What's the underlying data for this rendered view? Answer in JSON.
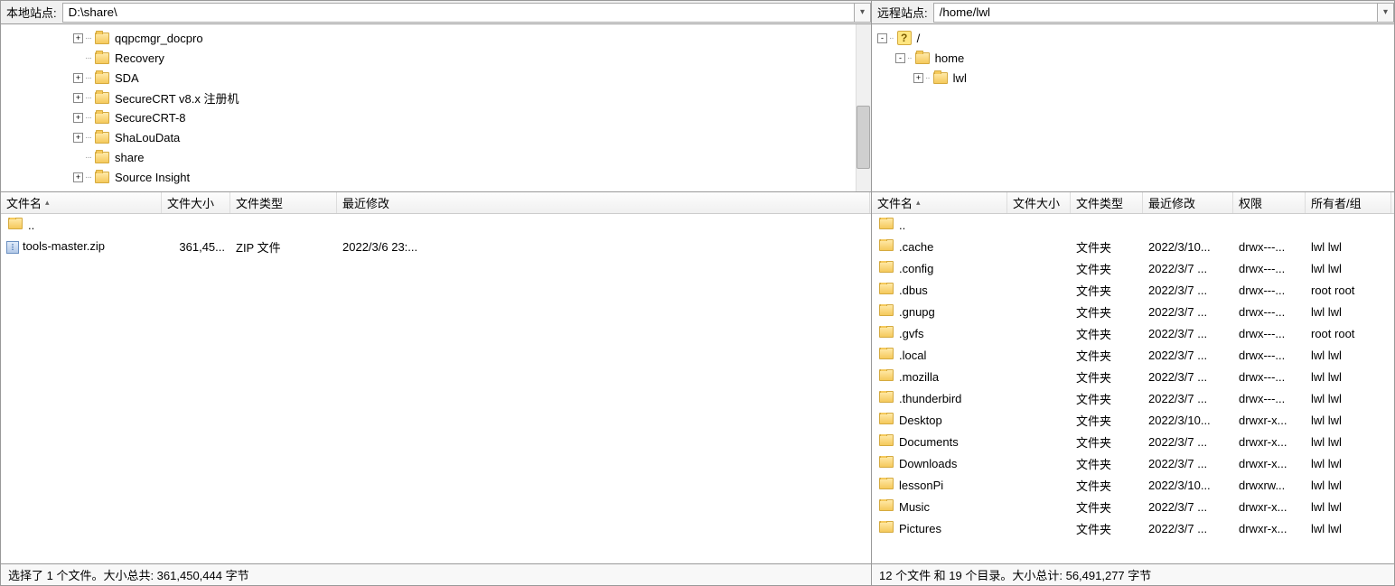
{
  "local": {
    "path_label": "本地站点:",
    "path_value": "D:\\share\\",
    "tree": [
      {
        "indent": 80,
        "toggle": "+",
        "name": "qqpcmgr_docpro"
      },
      {
        "indent": 80,
        "toggle": "",
        "name": "Recovery"
      },
      {
        "indent": 80,
        "toggle": "+",
        "name": "SDA"
      },
      {
        "indent": 80,
        "toggle": "+",
        "name": "SecureCRT v8.x 注册机"
      },
      {
        "indent": 80,
        "toggle": "+",
        "name": "SecureCRT-8"
      },
      {
        "indent": 80,
        "toggle": "+",
        "name": "ShaLouData"
      },
      {
        "indent": 80,
        "toggle": "",
        "name": "share"
      },
      {
        "indent": 80,
        "toggle": "+",
        "name": "Source Insight"
      }
    ],
    "headers": {
      "name": "文件名",
      "size": "文件大小",
      "type": "文件类型",
      "date": "最近修改"
    },
    "files": [
      {
        "icon": "parent",
        "name": ".."
      },
      {
        "icon": "zip",
        "name": "tools-master.zip",
        "size": "361,45...",
        "type": "ZIP 文件",
        "date": "2022/3/6 23:..."
      }
    ],
    "status": "选择了 1 个文件。大小总共: 361,450,444 字节"
  },
  "remote": {
    "path_label": "远程站点:",
    "path_value": "/home/lwl",
    "tree": [
      {
        "indent": 0,
        "toggle": "-",
        "name": "/",
        "icon": "question"
      },
      {
        "indent": 20,
        "toggle": "-",
        "name": "home",
        "icon": "folder"
      },
      {
        "indent": 40,
        "toggle": "+",
        "name": "lwl",
        "icon": "folder"
      }
    ],
    "headers": {
      "name": "文件名",
      "size": "文件大小",
      "type": "文件类型",
      "date": "最近修改",
      "perm": "权限",
      "owner": "所有者/组"
    },
    "files": [
      {
        "icon": "parent",
        "name": ".."
      },
      {
        "icon": "folder",
        "name": ".cache",
        "size": "",
        "type": "文件夹",
        "date": "2022/3/10...",
        "perm": "drwx---...",
        "owner": "lwl lwl"
      },
      {
        "icon": "folder",
        "name": ".config",
        "size": "",
        "type": "文件夹",
        "date": "2022/3/7 ...",
        "perm": "drwx---...",
        "owner": "lwl lwl"
      },
      {
        "icon": "folder",
        "name": ".dbus",
        "size": "",
        "type": "文件夹",
        "date": "2022/3/7 ...",
        "perm": "drwx---...",
        "owner": "root root"
      },
      {
        "icon": "folder",
        "name": ".gnupg",
        "size": "",
        "type": "文件夹",
        "date": "2022/3/7 ...",
        "perm": "drwx---...",
        "owner": "lwl lwl"
      },
      {
        "icon": "folder",
        "name": ".gvfs",
        "size": "",
        "type": "文件夹",
        "date": "2022/3/7 ...",
        "perm": "drwx---...",
        "owner": "root root"
      },
      {
        "icon": "folder",
        "name": ".local",
        "size": "",
        "type": "文件夹",
        "date": "2022/3/7 ...",
        "perm": "drwx---...",
        "owner": "lwl lwl"
      },
      {
        "icon": "folder",
        "name": ".mozilla",
        "size": "",
        "type": "文件夹",
        "date": "2022/3/7 ...",
        "perm": "drwx---...",
        "owner": "lwl lwl"
      },
      {
        "icon": "folder",
        "name": ".thunderbird",
        "size": "",
        "type": "文件夹",
        "date": "2022/3/7 ...",
        "perm": "drwx---...",
        "owner": "lwl lwl"
      },
      {
        "icon": "folder",
        "name": "Desktop",
        "size": "",
        "type": "文件夹",
        "date": "2022/3/10...",
        "perm": "drwxr-x...",
        "owner": "lwl lwl"
      },
      {
        "icon": "folder",
        "name": "Documents",
        "size": "",
        "type": "文件夹",
        "date": "2022/3/7 ...",
        "perm": "drwxr-x...",
        "owner": "lwl lwl"
      },
      {
        "icon": "folder",
        "name": "Downloads",
        "size": "",
        "type": "文件夹",
        "date": "2022/3/7 ...",
        "perm": "drwxr-x...",
        "owner": "lwl lwl"
      },
      {
        "icon": "folder",
        "name": "lessonPi",
        "size": "",
        "type": "文件夹",
        "date": "2022/3/10...",
        "perm": "drwxrw...",
        "owner": "lwl lwl"
      },
      {
        "icon": "folder",
        "name": "Music",
        "size": "",
        "type": "文件夹",
        "date": "2022/3/7 ...",
        "perm": "drwxr-x...",
        "owner": "lwl lwl"
      },
      {
        "icon": "folder",
        "name": "Pictures",
        "size": "",
        "type": "文件夹",
        "date": "2022/3/7 ...",
        "perm": "drwxr-x...",
        "owner": "lwl lwl"
      }
    ],
    "status": "12 个文件 和 19 个目录。大小总计: 56,491,277 字节"
  }
}
